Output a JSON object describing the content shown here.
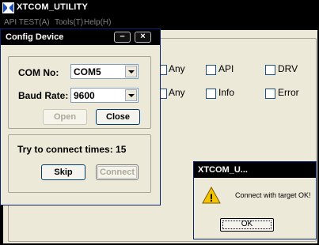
{
  "main": {
    "title": "XTCOM_UTILITY",
    "menu": [
      "API TEST(A)",
      "Tools(T)",
      "Help(H)"
    ],
    "filters_row1": [
      "Any",
      "API",
      "DRV"
    ],
    "filters_row2": [
      "Any",
      "Info",
      "Error"
    ]
  },
  "config": {
    "title": "Config Device",
    "minimize_glyph": "–",
    "close_glyph": "×",
    "com_label": "COM No:",
    "com_value": "COM5",
    "baud_label": "Baud Rate:",
    "baud_value": "9600",
    "open_label": "Open",
    "close_label": "Close",
    "status": "Try to connect times: 15",
    "skip_label": "Skip",
    "connect_label": "Connect"
  },
  "msgbox": {
    "title": "XTCOM_U...",
    "message": "Connect with target OK!",
    "ok_label": "OK",
    "warning_glyph": "!"
  }
}
